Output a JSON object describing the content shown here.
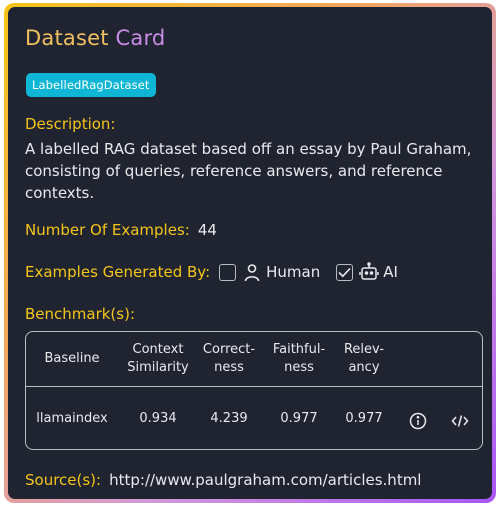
{
  "title": {
    "part1": "Dataset",
    "part2": "Card"
  },
  "badge": "LabelledRagDataset",
  "description": {
    "label": "Description:",
    "text": "A labelled RAG dataset based off an essay by Paul Graham, consisting of queries, reference answers, and reference contexts."
  },
  "examples": {
    "label": "Number Of Examples:",
    "value": "44"
  },
  "generated_by": {
    "label": "Examples Generated By:",
    "options": [
      {
        "label": "Human",
        "checked": false,
        "icon": "person-icon"
      },
      {
        "label": "AI",
        "checked": true,
        "icon": "robot-icon"
      }
    ]
  },
  "benchmark": {
    "label": "Benchmark(s):",
    "headers": {
      "baseline": "Baseline",
      "context_line1": "Context",
      "context_line2": "Similarity",
      "correct_line1": "Correct-",
      "correct_line2": "ness",
      "faith_line1": "Faithful-",
      "faith_line2": "ness",
      "relev_line1": "Relev-",
      "relev_line2": "ancy"
    },
    "rows": [
      {
        "baseline": "llamaindex",
        "context_similarity": "0.934",
        "correctness": "4.239",
        "faithfulness": "0.977",
        "relevancy": "0.977"
      }
    ]
  },
  "source": {
    "label": "Source(s):",
    "url": "http://www.paulgraham.com/articles.html"
  },
  "colors": {
    "label": "#f5c518",
    "badge": "#0fb5d4",
    "background": "#1f2430"
  }
}
